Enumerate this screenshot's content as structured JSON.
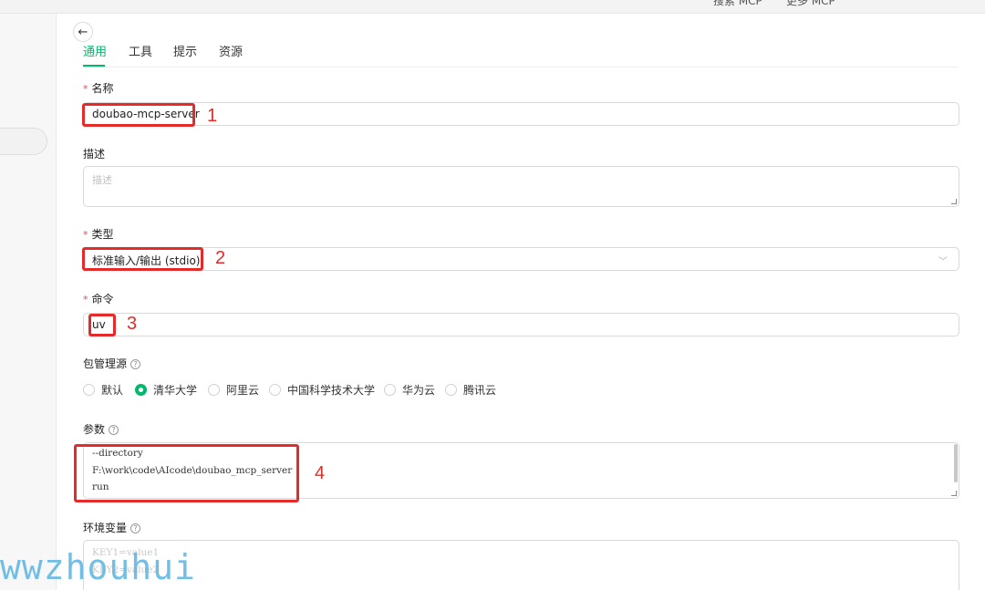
{
  "topbar": {
    "items": [
      "搜索 MCP",
      "更多 MCP"
    ]
  },
  "tabs": [
    {
      "label": "通用",
      "active": true
    },
    {
      "label": "工具",
      "active": false
    },
    {
      "label": "提示",
      "active": false
    },
    {
      "label": "资源",
      "active": false
    }
  ],
  "form": {
    "name": {
      "label": "名称",
      "required": true,
      "value": "doubao-mcp-server"
    },
    "description": {
      "label": "描述",
      "placeholder": "描述"
    },
    "type": {
      "label": "类型",
      "required": true,
      "value": "标准输入/输出 (stdio)"
    },
    "command": {
      "label": "命令",
      "required": true,
      "value": "uv"
    },
    "registry": {
      "label": "包管理源",
      "options": [
        "默认",
        "清华大学",
        "阿里云",
        "中国科学技术大学",
        "华为云",
        "腾讯云"
      ],
      "selected": "清华大学"
    },
    "args": {
      "label": "参数",
      "lines": [
        "--directory",
        "F:\\work\\code\\AIcode\\doubao_mcp_server",
        "run"
      ]
    },
    "env": {
      "label": "环境变量",
      "placeholder_lines": [
        "KEY1=value1",
        "KEY2=value2"
      ]
    }
  },
  "annotations": [
    "1",
    "2",
    "3",
    "4"
  ],
  "watermark": "wwzhouhui",
  "colors": {
    "accent": "#00b96b",
    "annotation": "#e52a2a",
    "required": "#e34d4d"
  }
}
